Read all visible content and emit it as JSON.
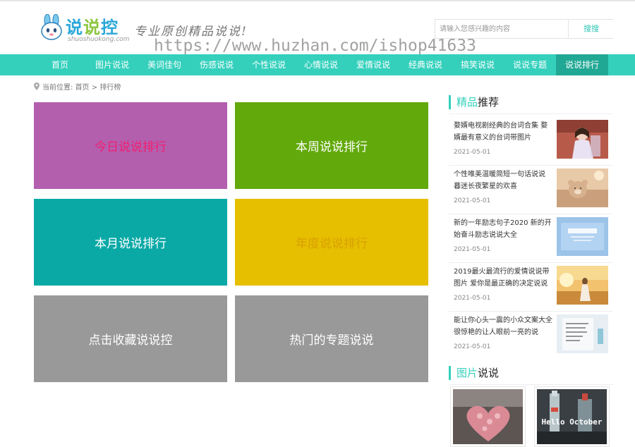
{
  "header": {
    "logo_text_1": "说",
    "logo_text_2": "说",
    "logo_text_3": "控",
    "logo_sub": "shuoshuokong.com",
    "slogan": "专业原创精品说说!",
    "watermark": "https://www.huzhan.com/ishop41633",
    "search_placeholder": "请输入您感兴趣的内容",
    "search_button": "搜搜"
  },
  "nav": {
    "items": [
      {
        "label": "首页"
      },
      {
        "label": "图片说说"
      },
      {
        "label": "美词佳句"
      },
      {
        "label": "伤感说说"
      },
      {
        "label": "个性说说"
      },
      {
        "label": "心情说说"
      },
      {
        "label": "爱情说说"
      },
      {
        "label": "经典说说"
      },
      {
        "label": "搞笑说说"
      },
      {
        "label": "说说专题"
      },
      {
        "label": "说说排行"
      }
    ],
    "active_index": 10
  },
  "breadcrumb": {
    "prefix": "当前位置:",
    "home": "首页",
    "sep": ">",
    "current": "排行榜"
  },
  "tiles": [
    {
      "label": "今日说说排行",
      "bg": "#b35fae",
      "color": "#f0206f"
    },
    {
      "label": "本周说说排行",
      "bg": "#62a90b",
      "color": "#ffffff"
    },
    {
      "label": "本月说说排行",
      "bg": "#0aa9a6",
      "color": "#ffffff"
    },
    {
      "label": "年度说说排行",
      "bg": "#e6bf00",
      "color": "#d9a000"
    },
    {
      "label": "点击收藏说说控",
      "bg": "#999999",
      "color": "#ffffff"
    },
    {
      "label": "热门的专题说说",
      "bg": "#999999",
      "color": "#ffffff"
    }
  ],
  "sidebar": {
    "recommend_title_hl": "精品",
    "recommend_title": "推荐",
    "items": [
      {
        "title": "婺婿电视剧经典的台词合集 婺婿最有意义的台词带图片",
        "date": "2021-05-01",
        "thumb": "girl-photo"
      },
      {
        "title": "个性唯美温暖简短一句话说说 暮迷长夜繁星的欢喜",
        "date": "2021-05-01",
        "thumb": "bear-photo"
      },
      {
        "title": "新的一年励志句子2020 新的开始奋斗励志说说大全",
        "date": "2021-05-01",
        "thumb": "blue-text-photo"
      },
      {
        "title": "2019最火最流行的爱情说说带图片 爱你是最正确的决定说说",
        "date": "2021-05-01",
        "thumb": "sunset-photo"
      },
      {
        "title": "能让你心头一震的小众文案大全 很惊艳的让人眼前一亮的说",
        "date": "2021-05-01",
        "thumb": "handwriting-photo"
      }
    ],
    "pics_title_hl": "图片",
    "pics_title": "说说",
    "pics": [
      {
        "thumb": "heart-flowers-photo"
      },
      {
        "thumb": "hello-october-photo",
        "caption": "Hello October"
      }
    ]
  },
  "colors": {
    "accent": "#34d0bc",
    "nav_active": "#21a895"
  }
}
